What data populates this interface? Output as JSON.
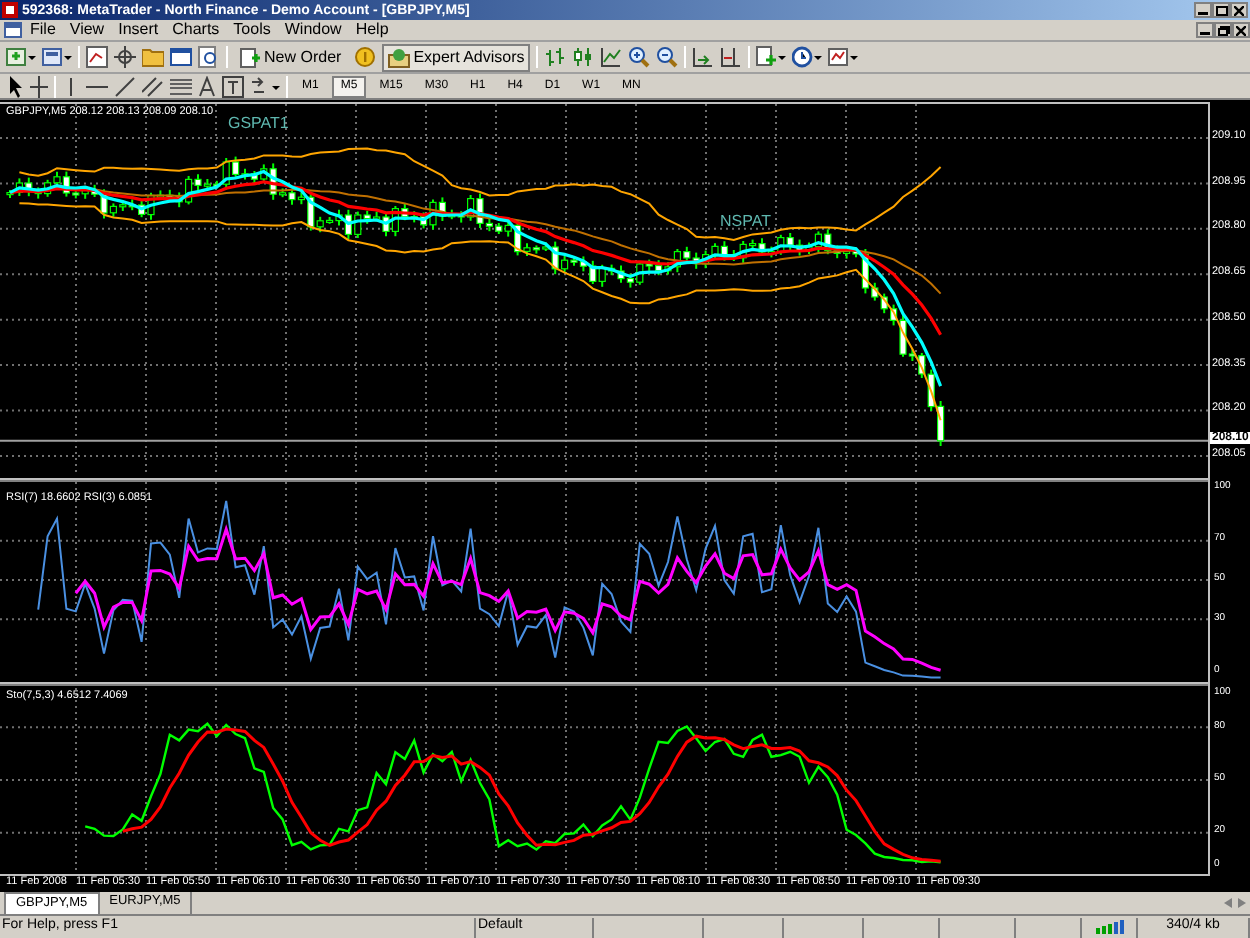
{
  "window": {
    "title": "592368: MetaTrader - North Finance - Demo Account - [GBPJPY,M5]"
  },
  "menu": [
    "File",
    "View",
    "Insert",
    "Charts",
    "Tools",
    "Window",
    "Help"
  ],
  "toolbar": {
    "buttons": [
      {
        "label": "New Order",
        "pressed": false
      },
      {
        "label": "Expert Advisors",
        "pressed": true
      }
    ]
  },
  "timeframes": [
    {
      "label": "M1",
      "selected": false
    },
    {
      "label": "M5",
      "selected": true
    },
    {
      "label": "M15",
      "selected": false
    },
    {
      "label": "M30",
      "selected": false
    },
    {
      "label": "H1",
      "selected": false
    },
    {
      "label": "H4",
      "selected": false
    },
    {
      "label": "D1",
      "selected": false
    },
    {
      "label": "W1",
      "selected": false
    },
    {
      "label": "MN",
      "selected": false
    }
  ],
  "chart": {
    "header": "GBPJPY,M5 208.12 208.13 208.09 208.10",
    "annotations": [
      "GSPAT1",
      "NSPAT"
    ],
    "price_axis": [
      {
        "label": "209.10",
        "kind": "tick"
      },
      {
        "label": "208.95",
        "kind": "tick"
      },
      {
        "label": "208.80",
        "kind": "tick"
      },
      {
        "label": "208.65",
        "kind": "tick"
      },
      {
        "label": "208.50",
        "kind": "tick"
      },
      {
        "label": "208.35",
        "kind": "tick"
      },
      {
        "label": "208.20",
        "kind": "tick"
      },
      {
        "label": "208.10",
        "kind": "current"
      },
      {
        "label": "208.05",
        "kind": "tick"
      }
    ],
    "rsi": {
      "header": "RSI(7) 18.6602 RSI(3) 6.0851",
      "axis": [
        "100",
        "70",
        "50",
        "30",
        "0"
      ]
    },
    "stochastic": {
      "header": "Sto(7,5,3) 4.6512 7.4069",
      "axis": [
        "100",
        "80",
        "50",
        "20",
        "0"
      ]
    },
    "time_axis": [
      "11 Feb 2008",
      "11 Feb 05:30",
      "11 Feb 05:50",
      "11 Feb 06:10",
      "11 Feb 06:30",
      "11 Feb 06:50",
      "11 Feb 07:10",
      "11 Feb 07:30",
      "11 Feb 07:50",
      "11 Feb 08:10",
      "11 Feb 08:30",
      "11 Feb 08:50",
      "11 Feb 09:10",
      "11 Feb 09:30"
    ]
  },
  "tabs": [
    {
      "label": "GBPJPY,M5",
      "selected": true
    },
    {
      "label": "EURJPY,M5",
      "selected": false
    }
  ],
  "status_bar": {
    "help": "For Help, press F1",
    "profile": "Default",
    "traffic": "340/4 kb"
  }
}
